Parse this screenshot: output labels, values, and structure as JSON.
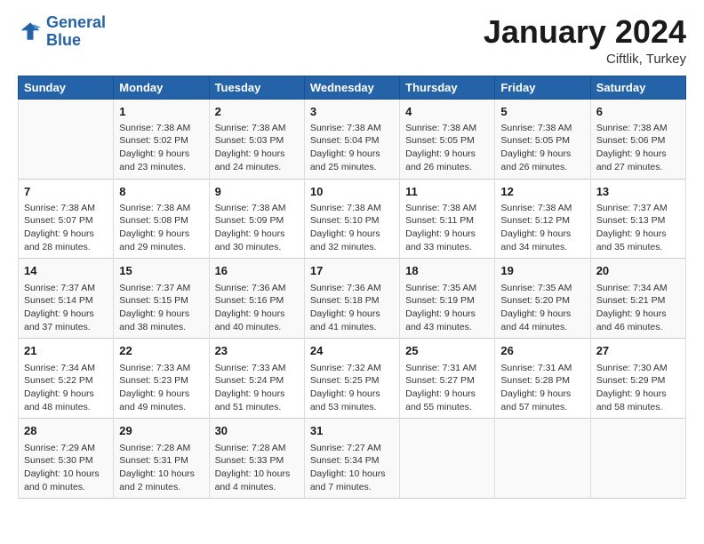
{
  "header": {
    "logo_line1": "General",
    "logo_line2": "Blue",
    "title": "January 2024",
    "subtitle": "Ciftlik, Turkey"
  },
  "columns": [
    "Sunday",
    "Monday",
    "Tuesday",
    "Wednesday",
    "Thursday",
    "Friday",
    "Saturday"
  ],
  "weeks": [
    [
      {
        "day": "",
        "sunrise": "",
        "sunset": "",
        "daylight": ""
      },
      {
        "day": "1",
        "sunrise": "Sunrise: 7:38 AM",
        "sunset": "Sunset: 5:02 PM",
        "daylight": "Daylight: 9 hours and 23 minutes."
      },
      {
        "day": "2",
        "sunrise": "Sunrise: 7:38 AM",
        "sunset": "Sunset: 5:03 PM",
        "daylight": "Daylight: 9 hours and 24 minutes."
      },
      {
        "day": "3",
        "sunrise": "Sunrise: 7:38 AM",
        "sunset": "Sunset: 5:04 PM",
        "daylight": "Daylight: 9 hours and 25 minutes."
      },
      {
        "day": "4",
        "sunrise": "Sunrise: 7:38 AM",
        "sunset": "Sunset: 5:05 PM",
        "daylight": "Daylight: 9 hours and 26 minutes."
      },
      {
        "day": "5",
        "sunrise": "Sunrise: 7:38 AM",
        "sunset": "Sunset: 5:05 PM",
        "daylight": "Daylight: 9 hours and 26 minutes."
      },
      {
        "day": "6",
        "sunrise": "Sunrise: 7:38 AM",
        "sunset": "Sunset: 5:06 PM",
        "daylight": "Daylight: 9 hours and 27 minutes."
      }
    ],
    [
      {
        "day": "7",
        "sunrise": "Sunrise: 7:38 AM",
        "sunset": "Sunset: 5:07 PM",
        "daylight": "Daylight: 9 hours and 28 minutes."
      },
      {
        "day": "8",
        "sunrise": "Sunrise: 7:38 AM",
        "sunset": "Sunset: 5:08 PM",
        "daylight": "Daylight: 9 hours and 29 minutes."
      },
      {
        "day": "9",
        "sunrise": "Sunrise: 7:38 AM",
        "sunset": "Sunset: 5:09 PM",
        "daylight": "Daylight: 9 hours and 30 minutes."
      },
      {
        "day": "10",
        "sunrise": "Sunrise: 7:38 AM",
        "sunset": "Sunset: 5:10 PM",
        "daylight": "Daylight: 9 hours and 32 minutes."
      },
      {
        "day": "11",
        "sunrise": "Sunrise: 7:38 AM",
        "sunset": "Sunset: 5:11 PM",
        "daylight": "Daylight: 9 hours and 33 minutes."
      },
      {
        "day": "12",
        "sunrise": "Sunrise: 7:38 AM",
        "sunset": "Sunset: 5:12 PM",
        "daylight": "Daylight: 9 hours and 34 minutes."
      },
      {
        "day": "13",
        "sunrise": "Sunrise: 7:37 AM",
        "sunset": "Sunset: 5:13 PM",
        "daylight": "Daylight: 9 hours and 35 minutes."
      }
    ],
    [
      {
        "day": "14",
        "sunrise": "Sunrise: 7:37 AM",
        "sunset": "Sunset: 5:14 PM",
        "daylight": "Daylight: 9 hours and 37 minutes."
      },
      {
        "day": "15",
        "sunrise": "Sunrise: 7:37 AM",
        "sunset": "Sunset: 5:15 PM",
        "daylight": "Daylight: 9 hours and 38 minutes."
      },
      {
        "day": "16",
        "sunrise": "Sunrise: 7:36 AM",
        "sunset": "Sunset: 5:16 PM",
        "daylight": "Daylight: 9 hours and 40 minutes."
      },
      {
        "day": "17",
        "sunrise": "Sunrise: 7:36 AM",
        "sunset": "Sunset: 5:18 PM",
        "daylight": "Daylight: 9 hours and 41 minutes."
      },
      {
        "day": "18",
        "sunrise": "Sunrise: 7:35 AM",
        "sunset": "Sunset: 5:19 PM",
        "daylight": "Daylight: 9 hours and 43 minutes."
      },
      {
        "day": "19",
        "sunrise": "Sunrise: 7:35 AM",
        "sunset": "Sunset: 5:20 PM",
        "daylight": "Daylight: 9 hours and 44 minutes."
      },
      {
        "day": "20",
        "sunrise": "Sunrise: 7:34 AM",
        "sunset": "Sunset: 5:21 PM",
        "daylight": "Daylight: 9 hours and 46 minutes."
      }
    ],
    [
      {
        "day": "21",
        "sunrise": "Sunrise: 7:34 AM",
        "sunset": "Sunset: 5:22 PM",
        "daylight": "Daylight: 9 hours and 48 minutes."
      },
      {
        "day": "22",
        "sunrise": "Sunrise: 7:33 AM",
        "sunset": "Sunset: 5:23 PM",
        "daylight": "Daylight: 9 hours and 49 minutes."
      },
      {
        "day": "23",
        "sunrise": "Sunrise: 7:33 AM",
        "sunset": "Sunset: 5:24 PM",
        "daylight": "Daylight: 9 hours and 51 minutes."
      },
      {
        "day": "24",
        "sunrise": "Sunrise: 7:32 AM",
        "sunset": "Sunset: 5:25 PM",
        "daylight": "Daylight: 9 hours and 53 minutes."
      },
      {
        "day": "25",
        "sunrise": "Sunrise: 7:31 AM",
        "sunset": "Sunset: 5:27 PM",
        "daylight": "Daylight: 9 hours and 55 minutes."
      },
      {
        "day": "26",
        "sunrise": "Sunrise: 7:31 AM",
        "sunset": "Sunset: 5:28 PM",
        "daylight": "Daylight: 9 hours and 57 minutes."
      },
      {
        "day": "27",
        "sunrise": "Sunrise: 7:30 AM",
        "sunset": "Sunset: 5:29 PM",
        "daylight": "Daylight: 9 hours and 58 minutes."
      }
    ],
    [
      {
        "day": "28",
        "sunrise": "Sunrise: 7:29 AM",
        "sunset": "Sunset: 5:30 PM",
        "daylight": "Daylight: 10 hours and 0 minutes."
      },
      {
        "day": "29",
        "sunrise": "Sunrise: 7:28 AM",
        "sunset": "Sunset: 5:31 PM",
        "daylight": "Daylight: 10 hours and 2 minutes."
      },
      {
        "day": "30",
        "sunrise": "Sunrise: 7:28 AM",
        "sunset": "Sunset: 5:33 PM",
        "daylight": "Daylight: 10 hours and 4 minutes."
      },
      {
        "day": "31",
        "sunrise": "Sunrise: 7:27 AM",
        "sunset": "Sunset: 5:34 PM",
        "daylight": "Daylight: 10 hours and 7 minutes."
      },
      {
        "day": "",
        "sunrise": "",
        "sunset": "",
        "daylight": ""
      },
      {
        "day": "",
        "sunrise": "",
        "sunset": "",
        "daylight": ""
      },
      {
        "day": "",
        "sunrise": "",
        "sunset": "",
        "daylight": ""
      }
    ]
  ]
}
